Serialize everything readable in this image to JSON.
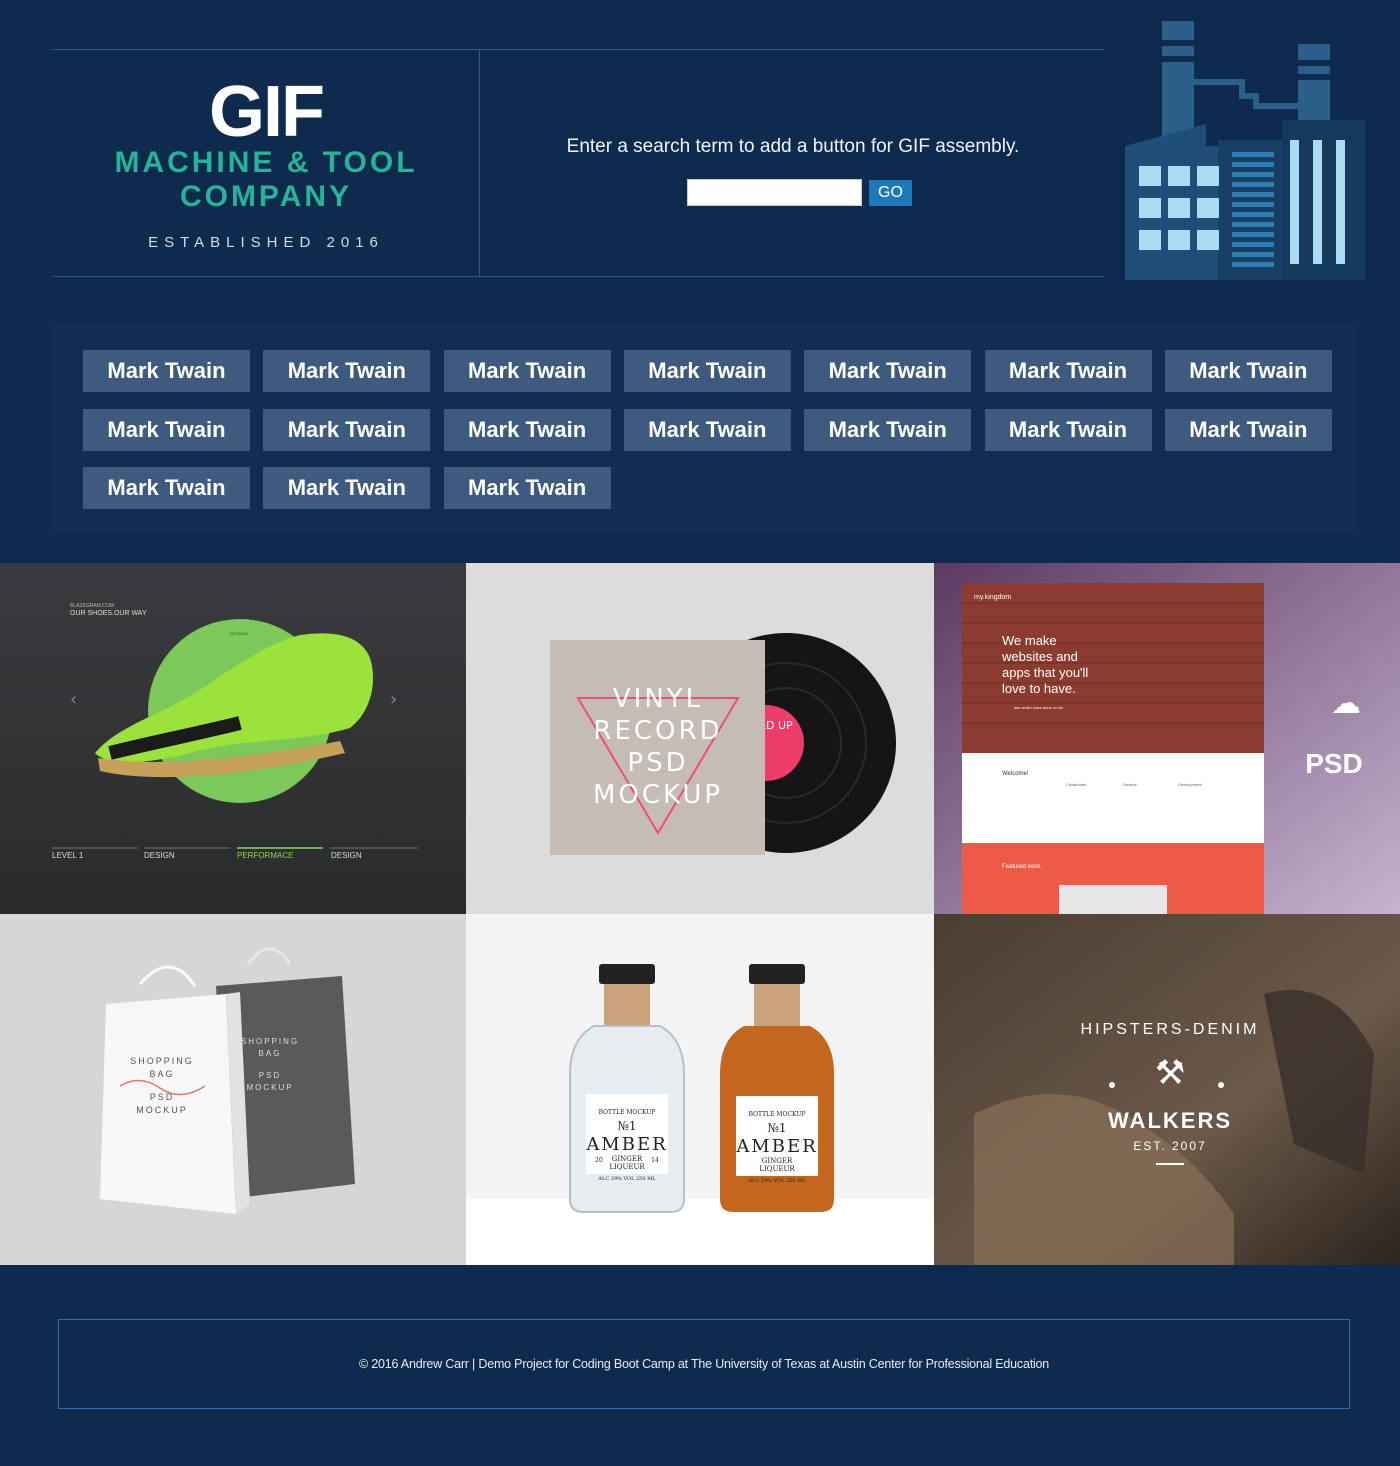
{
  "logo": {
    "title": "GIF",
    "subtitle_line1": "MACHINE & TOOL",
    "subtitle_line2": "COMPANY",
    "established": "ESTABLISHED 2016"
  },
  "search": {
    "prompt": "Enter a search term to add a button for GIF assembly.",
    "input_value": "",
    "button_label": "GO"
  },
  "topic_buttons": [
    "Mark Twain",
    "Mark Twain",
    "Mark Twain",
    "Mark Twain",
    "Mark Twain",
    "Mark Twain",
    "Mark Twain",
    "Mark Twain",
    "Mark Twain",
    "Mark Twain",
    "Mark Twain",
    "Mark Twain",
    "Mark Twain",
    "Mark Twain",
    "Mark Twain",
    "Mark Twain",
    "Mark Twain"
  ],
  "gallery": {
    "shoe": {
      "brand": "BLAZEGRAM.COM",
      "tagline": "OUR SHOES.OUR WAY",
      "small": "SECTION",
      "nav": [
        "LEVEL 1",
        "DESIGN",
        "PERFORMACE",
        "DESIGN"
      ]
    },
    "vinyl": {
      "lines": [
        "VINYL",
        "RECORD",
        "PSD",
        "MOCKUP"
      ],
      "label": "YL RD UP"
    },
    "website": {
      "brand": "my.kingdom",
      "headline": [
        "We make",
        "websites and",
        "apps that you'll",
        "love to have."
      ],
      "cta": "see what i have done so far",
      "welcome": "Welcome!",
      "features": [
        "Collaborate",
        "Creative",
        "Development"
      ],
      "featured": "Featured work.",
      "badge": "PSD"
    },
    "bags": {
      "lines": [
        "SHOPPING",
        "BAG",
        "PSD",
        "MOCKUP"
      ]
    },
    "bottles": {
      "top": "BOTTLE MOCKUP",
      "number": "№1",
      "name": "AMBER",
      "year_left": "20",
      "year_right": "14",
      "sub1": "GINGER",
      "sub2": "LIQUEUR",
      "abv": "ALC 29% VOL 250 ML"
    },
    "walkers": {
      "arc": "HIPSTERS-DENIM",
      "name": "WALKERS",
      "est": "EST. 2007"
    }
  },
  "footer": {
    "text": "© 2016 Andrew Carr  |  Demo Project for Coding Boot Camp at The University of Texas at Austin Center for Professional Education"
  },
  "colors": {
    "background": "#0e2a4d",
    "accent_teal": "#27b39a",
    "button": "#3e5a7c",
    "go_button": "#1f79b9"
  }
}
